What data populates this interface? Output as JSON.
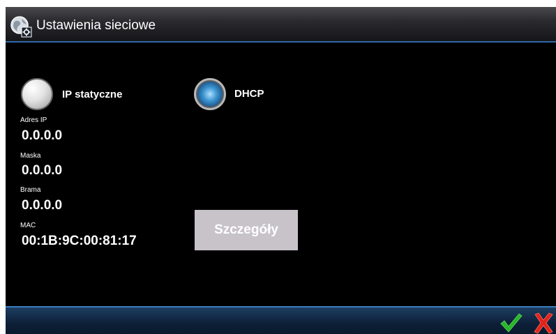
{
  "window": {
    "title": "Ustawienia sieciowe",
    "icon": "globe-settings-icon"
  },
  "mode": {
    "static_ip": {
      "label": "IP statyczne",
      "selected": false
    },
    "dhcp": {
      "label": "DHCP",
      "selected": true
    }
  },
  "fields": {
    "ip": {
      "label": "Adres IP",
      "value": "0.0.0.0"
    },
    "mask": {
      "label": "Maska",
      "value": "0.0.0.0"
    },
    "gateway": {
      "label": "Brama",
      "value": "0.0.0.0"
    },
    "mac": {
      "label": "MAC",
      "value": "00:1B:9C:00:81:17"
    }
  },
  "buttons": {
    "details": "Szczegóły"
  },
  "footer": {
    "ok_icon": "checkmark-icon",
    "cancel_icon": "close-icon",
    "ok_color": "#2ab52a",
    "cancel_color": "#e0241c"
  }
}
